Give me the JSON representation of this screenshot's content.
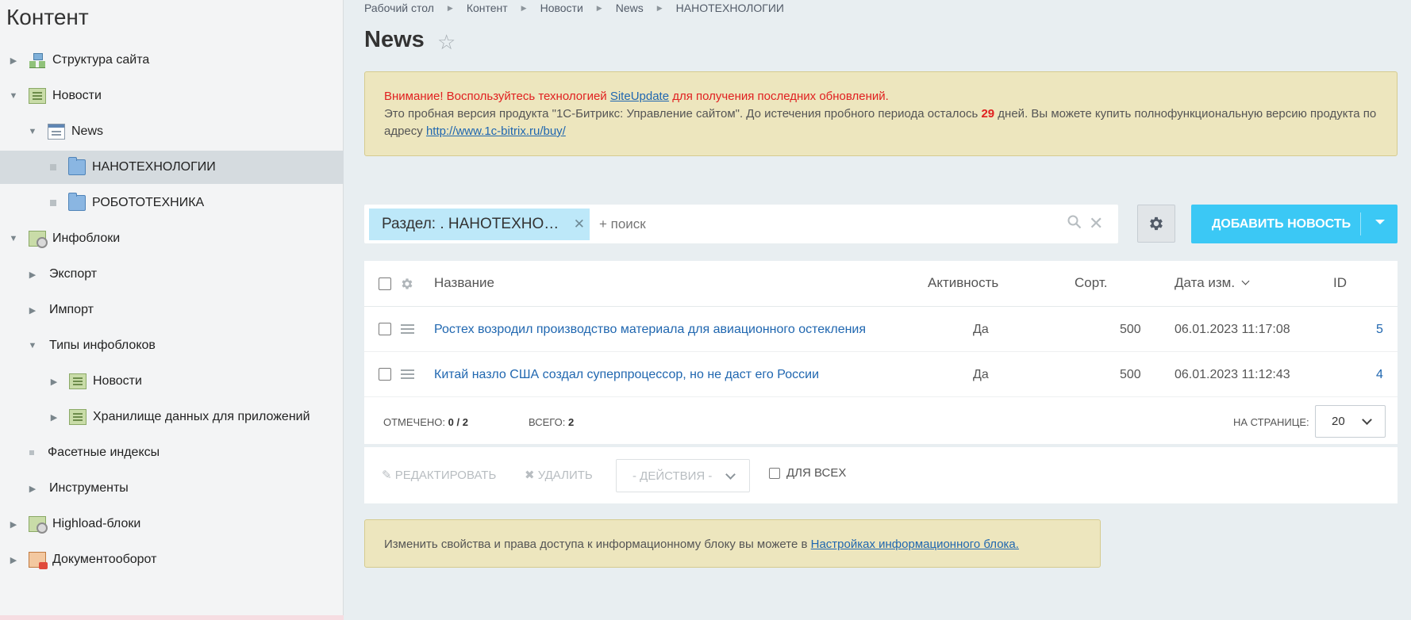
{
  "sidebar": {
    "title": "Контент",
    "items": [
      {
        "label": "Структура сайта"
      },
      {
        "label": "Новости"
      },
      {
        "label": "News"
      },
      {
        "label": "НАНОТЕХНОЛОГИИ"
      },
      {
        "label": "РОБОТОТЕХНИКА"
      },
      {
        "label": "Инфоблоки"
      },
      {
        "label": "Экспорт"
      },
      {
        "label": "Импорт"
      },
      {
        "label": "Типы инфоблоков"
      },
      {
        "label": "Новости"
      },
      {
        "label": "Хранилище данных для приложений"
      },
      {
        "label": "Фасетные индексы"
      },
      {
        "label": "Инструменты"
      },
      {
        "label": "Highload-блоки"
      },
      {
        "label": "Документооборот"
      }
    ]
  },
  "breadcrumb": [
    "Рабочий стол",
    "Контент",
    "Новости",
    "News",
    "НАНОТЕХНОЛОГИИ"
  ],
  "page_title": "News",
  "notice": {
    "warn_prefix": "Внимание! Воспользуйтесь технологией ",
    "link": "SiteUpdate",
    "warn_suffix": " для получения последних обновлений.",
    "trial_text": "Это пробная версия продукта \"1С-Битрикс: Управление сайтом\". До истечения пробного периода осталось ",
    "days": "29",
    "trial_text2": " дней. Вы можете купить полнофункциональную версию продукта по адресу ",
    "buy_url": "http://www.1c-bitrix.ru/buy/"
  },
  "filter": {
    "chip": "Раздел: . НАНОТЕХНО…",
    "placeholder": "+ поиск"
  },
  "add_button": "ДОБАВИТЬ НОВОСТЬ",
  "grid": {
    "columns": {
      "name": "Название",
      "active": "Активность",
      "sort": "Сорт.",
      "date": "Дата изм.",
      "id": "ID"
    },
    "rows": [
      {
        "name": "Ростех возродил производство материала для авиационного остекления",
        "active": "Да",
        "sort": "500",
        "date": "06.01.2023 11:17:08",
        "id": "5"
      },
      {
        "name": "Китай назло США создал суперпроцессор, но не даст его России",
        "active": "Да",
        "sort": "500",
        "date": "06.01.2023 11:12:43",
        "id": "4"
      }
    ],
    "footer": {
      "checked_label": "ОТМЕЧЕНО:",
      "checked_value": "0 / 2",
      "total_label": "ВСЕГО:",
      "total_value": "2",
      "per_page_label": "НА СТРАНИЦЕ:",
      "per_page_value": "20"
    }
  },
  "actions": {
    "edit": "РЕДАКТИРОВАТЬ",
    "delete": "УДАЛИТЬ",
    "select": "- ДЕЙСТВИЯ -",
    "for_all": "ДЛЯ ВСЕХ"
  },
  "info_note": {
    "text": "Изменить свойства и права доступа к информационному блоку вы можете в ",
    "link": "Настройках информационного блока."
  }
}
